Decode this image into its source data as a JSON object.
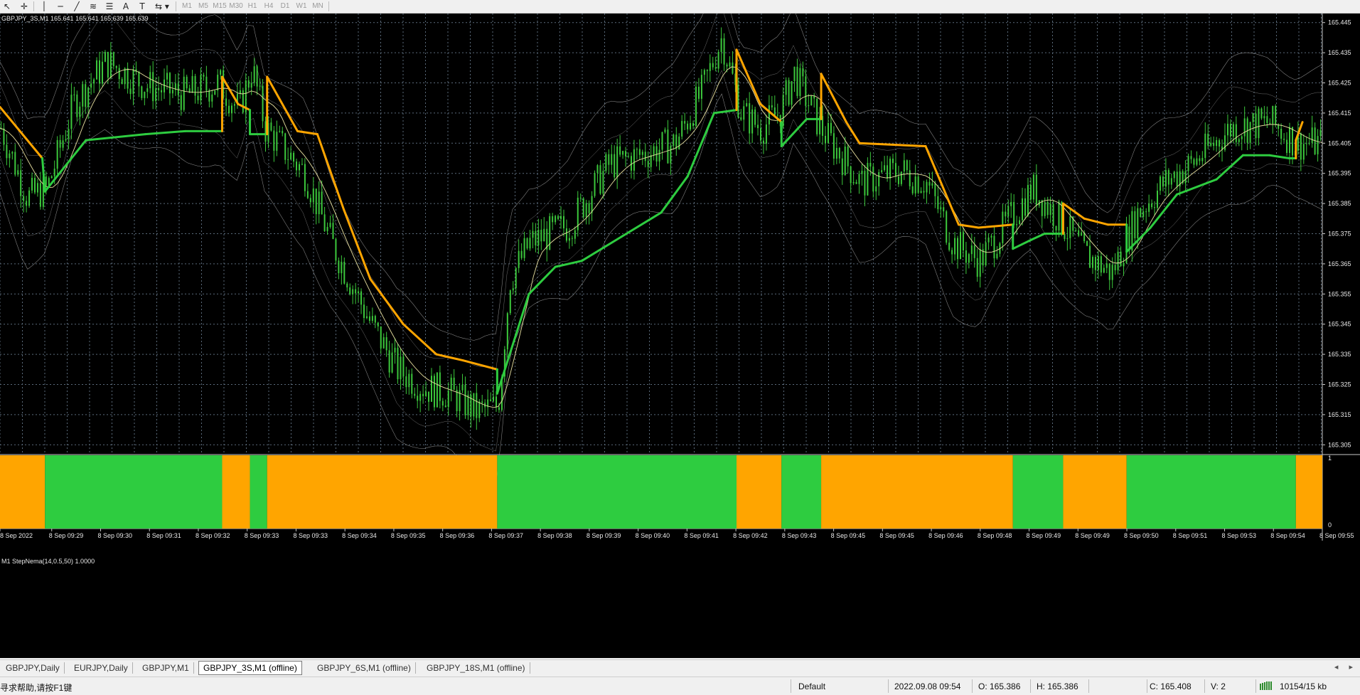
{
  "toolbar": {
    "icons": [
      "cursor-icon",
      "crosshair-icon",
      "vertical-line-icon",
      "horizontal-line-icon",
      "trendline-icon",
      "channel-icon",
      "fibonacci-icon",
      "text-icon",
      "text-label-icon",
      "arrows-icon"
    ],
    "glyphs": {
      "cursor": "↖",
      "crosshair": "✛",
      "vline": "│",
      "hline": "─",
      "trend": "╱",
      "channel": "≋",
      "fibo": "☰",
      "text": "A",
      "label": "T",
      "arrows": "⇆ ▾"
    },
    "timeframes": [
      "M1",
      "M5",
      "M15",
      "M30",
      "H1",
      "H4",
      "D1",
      "W1",
      "MN"
    ]
  },
  "chart": {
    "title": "GBPJPY_3S,M1  165.641 165.641 165.639 165.639",
    "indicator_label": "M1 StepNema(14,0.5,50) 1.0000",
    "indicator_scale": [
      "1",
      "0"
    ],
    "price_ticks": [
      "165.445",
      "165.435",
      "165.425",
      "165.415",
      "165.405",
      "165.395",
      "165.385",
      "165.375",
      "165.365",
      "165.355",
      "165.345",
      "165.335",
      "165.325",
      "165.315",
      "165.305"
    ],
    "time_ticks": [
      "8 Sep 2022",
      "8 Sep 09:29",
      "8 Sep 09:30",
      "8 Sep 09:31",
      "8 Sep 09:32",
      "8 Sep 09:33",
      "8 Sep 09:33",
      "8 Sep 09:34",
      "8 Sep 09:35",
      "8 Sep 09:36",
      "8 Sep 09:37",
      "8 Sep 09:38",
      "8 Sep 09:39",
      "8 Sep 09:40",
      "8 Sep 09:41",
      "8 Sep 09:42",
      "8 Sep 09:43",
      "8 Sep 09:45",
      "8 Sep 09:45",
      "8 Sep 09:46",
      "8 Sep 09:48",
      "8 Sep 09:49",
      "8 Sep 09:49",
      "8 Sep 09:50",
      "8 Sep 09:51",
      "8 Sep 09:53",
      "8 Sep 09:54",
      "8 Sep 09:55"
    ],
    "colors": {
      "background": "#000000",
      "grid": "#5a6a7a",
      "candle": "#3cc83c",
      "step_up": "#2ecc40",
      "step_down": "#ffa500",
      "ma": "#e8e0a0",
      "band": "#9a9a9a",
      "text": "#e8e8e8"
    },
    "step_segments": [
      {
        "state": "down",
        "from": 0.0,
        "to": 0.034
      },
      {
        "state": "up",
        "from": 0.034,
        "to": 0.168
      },
      {
        "state": "down",
        "from": 0.168,
        "to": 0.189
      },
      {
        "state": "up",
        "from": 0.189,
        "to": 0.202
      },
      {
        "state": "down",
        "from": 0.202,
        "to": 0.376
      },
      {
        "state": "up",
        "from": 0.376,
        "to": 0.557
      },
      {
        "state": "down",
        "from": 0.557,
        "to": 0.591
      },
      {
        "state": "up",
        "from": 0.591,
        "to": 0.621
      },
      {
        "state": "down",
        "from": 0.621,
        "to": 0.766
      },
      {
        "state": "up",
        "from": 0.766,
        "to": 0.804
      },
      {
        "state": "down",
        "from": 0.804,
        "to": 0.852
      },
      {
        "state": "up",
        "from": 0.852,
        "to": 0.98
      },
      {
        "state": "down",
        "from": 0.98,
        "to": 1.0
      }
    ],
    "price_path": [
      [
        0.0,
        165.41
      ],
      [
        0.02,
        165.387
      ],
      [
        0.035,
        165.39
      ],
      [
        0.055,
        165.418
      ],
      [
        0.08,
        165.432
      ],
      [
        0.11,
        165.424
      ],
      [
        0.14,
        165.421
      ],
      [
        0.165,
        165.425
      ],
      [
        0.18,
        165.416
      ],
      [
        0.19,
        165.43
      ],
      [
        0.2,
        165.41
      ],
      [
        0.23,
        165.395
      ],
      [
        0.25,
        165.372
      ],
      [
        0.28,
        165.345
      ],
      [
        0.3,
        165.33
      ],
      [
        0.32,
        165.324
      ],
      [
        0.34,
        165.322
      ],
      [
        0.36,
        165.316
      ],
      [
        0.376,
        165.318
      ],
      [
        0.385,
        165.36
      ],
      [
        0.4,
        165.372
      ],
      [
        0.43,
        165.378
      ],
      [
        0.46,
        165.398
      ],
      [
        0.49,
        165.402
      ],
      [
        0.51,
        165.405
      ],
      [
        0.53,
        165.422
      ],
      [
        0.545,
        165.44
      ],
      [
        0.56,
        165.415
      ],
      [
        0.575,
        165.41
      ],
      [
        0.59,
        165.416
      ],
      [
        0.6,
        165.428
      ],
      [
        0.62,
        165.41
      ],
      [
        0.65,
        165.392
      ],
      [
        0.68,
        165.396
      ],
      [
        0.7,
        165.392
      ],
      [
        0.72,
        165.372
      ],
      [
        0.74,
        165.366
      ],
      [
        0.76,
        165.378
      ],
      [
        0.78,
        165.39
      ],
      [
        0.8,
        165.38
      ],
      [
        0.82,
        165.368
      ],
      [
        0.84,
        165.362
      ],
      [
        0.86,
        165.382
      ],
      [
        0.88,
        165.392
      ],
      [
        0.9,
        165.398
      ],
      [
        0.93,
        165.41
      ],
      [
        0.96,
        165.412
      ],
      [
        0.98,
        165.405
      ]
    ],
    "step_path": [
      [
        0.0,
        165.417,
        "down"
      ],
      [
        0.032,
        165.4,
        "down"
      ],
      [
        0.034,
        165.389,
        "up"
      ],
      [
        0.065,
        165.406,
        "up"
      ],
      [
        0.11,
        165.408,
        "up"
      ],
      [
        0.14,
        165.409,
        "up"
      ],
      [
        0.168,
        165.409,
        "up"
      ],
      [
        0.168,
        165.427,
        "down"
      ],
      [
        0.18,
        165.418,
        "down"
      ],
      [
        0.189,
        165.416,
        "down"
      ],
      [
        0.189,
        165.408,
        "up"
      ],
      [
        0.202,
        165.408,
        "up"
      ],
      [
        0.202,
        165.427,
        "down"
      ],
      [
        0.225,
        165.409,
        "down"
      ],
      [
        0.24,
        165.408,
        "down"
      ],
      [
        0.26,
        165.383,
        "down"
      ],
      [
        0.28,
        165.36,
        "down"
      ],
      [
        0.305,
        165.345,
        "down"
      ],
      [
        0.33,
        165.335,
        "down"
      ],
      [
        0.35,
        165.333,
        "down"
      ],
      [
        0.376,
        165.33,
        "down"
      ],
      [
        0.376,
        165.322,
        "up"
      ],
      [
        0.4,
        165.355,
        "up"
      ],
      [
        0.42,
        165.364,
        "up"
      ],
      [
        0.44,
        165.366,
        "up"
      ],
      [
        0.47,
        165.374,
        "up"
      ],
      [
        0.5,
        165.382,
        "up"
      ],
      [
        0.52,
        165.394,
        "up"
      ],
      [
        0.54,
        165.415,
        "up"
      ],
      [
        0.557,
        165.416,
        "up"
      ],
      [
        0.557,
        165.436,
        "down"
      ],
      [
        0.575,
        165.418,
        "down"
      ],
      [
        0.591,
        165.412,
        "down"
      ],
      [
        0.591,
        165.404,
        "up"
      ],
      [
        0.61,
        165.413,
        "up"
      ],
      [
        0.621,
        165.413,
        "up"
      ],
      [
        0.621,
        165.428,
        "down"
      ],
      [
        0.64,
        165.412,
        "down"
      ],
      [
        0.65,
        165.405,
        "down"
      ],
      [
        0.7,
        165.404,
        "down"
      ],
      [
        0.725,
        165.378,
        "down"
      ],
      [
        0.74,
        165.377,
        "down"
      ],
      [
        0.766,
        165.378,
        "down"
      ],
      [
        0.766,
        165.37,
        "up"
      ],
      [
        0.78,
        165.373,
        "up"
      ],
      [
        0.79,
        165.375,
        "up"
      ],
      [
        0.804,
        165.375,
        "up"
      ],
      [
        0.804,
        165.385,
        "down"
      ],
      [
        0.82,
        165.38,
        "down"
      ],
      [
        0.838,
        165.378,
        "down"
      ],
      [
        0.852,
        165.378,
        "down"
      ],
      [
        0.852,
        165.369,
        "up"
      ],
      [
        0.87,
        165.377,
        "up"
      ],
      [
        0.89,
        165.388,
        "up"
      ],
      [
        0.92,
        165.393,
        "up"
      ],
      [
        0.94,
        165.401,
        "up"
      ],
      [
        0.96,
        165.401,
        "up"
      ],
      [
        0.975,
        165.4,
        "up"
      ],
      [
        0.98,
        165.4,
        "up"
      ],
      [
        0.98,
        165.406,
        "down"
      ],
      [
        0.985,
        165.412,
        "down"
      ]
    ]
  },
  "tabs": [
    {
      "label": "GBPJPY,Daily",
      "active": false
    },
    {
      "label": "EURJPY,Daily",
      "active": false
    },
    {
      "label": "GBPJPY,M1",
      "active": false
    },
    {
      "label": "GBPJPY_3S,M1 (offline)",
      "active": true
    },
    {
      "label": "GBPJPY_6S,M1 (offline)",
      "active": false
    },
    {
      "label": "GBPJPY_18S,M1 (offline)",
      "active": false
    }
  ],
  "tab_scroll": "◂ ▸",
  "status": {
    "help": "寻求帮助,请按F1键",
    "profile": "Default",
    "datetime": "2022.09.08 09:54",
    "open": "O: 165.386",
    "high": "H: 165.386",
    "close": "C: 165.408",
    "volume": "V: 2",
    "traffic": "10154/15 kb"
  }
}
